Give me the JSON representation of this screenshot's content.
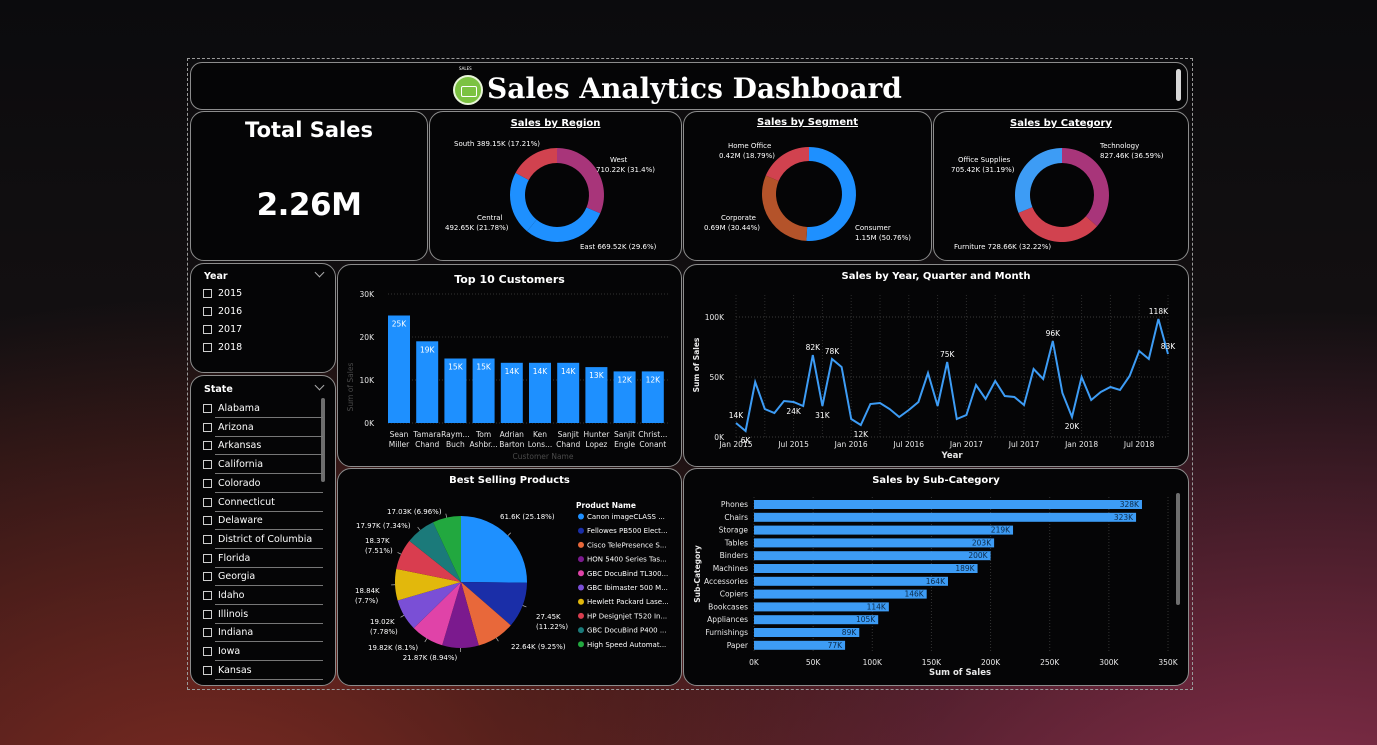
{
  "header": {
    "title": "Sales Analytics Dashboard",
    "logo_text": "SALES"
  },
  "kpi": {
    "label": "Total Sales",
    "value": "2.26M"
  },
  "region": {
    "title": "Sales by Region",
    "labels": [
      "West\n710.22K (31.4%)",
      "East 669.52K (29.6%)",
      "Central\n492.65K (21.78%)",
      "South 389.15K (17.21%)"
    ]
  },
  "segment": {
    "title": "Sales by Segment",
    "labels": [
      "Consumer\n1.15M (50.76%)",
      "Corporate\n0.69M (30.44%)",
      "Home Office\n0.42M (18.79%)"
    ]
  },
  "category": {
    "title": "Sales by Category",
    "labels": [
      "Technology\n827.46K (36.59%)",
      "Furniture 728.66K (32.22%)",
      "Office Supplies\n705.42K (31.19%)"
    ]
  },
  "year_slicer": {
    "title": "Year",
    "items": [
      "2015",
      "2016",
      "2017",
      "2018"
    ]
  },
  "state_slicer": {
    "title": "State",
    "items": [
      "Alabama",
      "Arizona",
      "Arkansas",
      "California",
      "Colorado",
      "Connecticut",
      "Delaware",
      "District of Columbia",
      "Florida",
      "Georgia",
      "Idaho",
      "Illinois",
      "Indiana",
      "Iowa",
      "Kansas"
    ]
  },
  "top_customers": {
    "title": "Top 10 Customers",
    "xlabel": "Customer Name",
    "ylabel": "Sum of Sales"
  },
  "timeline": {
    "title": "Sales by Year, Quarter and Month",
    "xlabel": "Year",
    "ylabel": "Sum of Sales"
  },
  "products": {
    "title": "Best Selling Products",
    "legend_title": "Product Name"
  },
  "subcat": {
    "title": "Sales by Sub-Category",
    "xlabel": "Sum of Sales",
    "ylabel": "Sub-Category"
  },
  "colors": {
    "blue": "#1e90ff",
    "purple": "#a8357a",
    "red": "#d1424f",
    "orange": "#b4532a",
    "lightblue": "#3d9cf5"
  },
  "chart_data": [
    {
      "type": "pie",
      "title": "Sales by Region",
      "categories": [
        "West",
        "East",
        "Central",
        "South"
      ],
      "values": [
        710.22,
        669.52,
        492.65,
        389.15
      ],
      "unit": "K",
      "colors": [
        "#a8357a",
        "#1e90ff",
        "#1e90ff",
        "#d1424f"
      ]
    },
    {
      "type": "pie",
      "title": "Sales by Segment",
      "categories": [
        "Consumer",
        "Corporate",
        "Home Office"
      ],
      "values": [
        1.15,
        0.69,
        0.42
      ],
      "unit": "M",
      "colors": [
        "#1e90ff",
        "#b4532a",
        "#d1424f"
      ]
    },
    {
      "type": "pie",
      "title": "Sales by Category",
      "categories": [
        "Technology",
        "Furniture",
        "Office Supplies"
      ],
      "values": [
        827.46,
        728.66,
        705.42
      ],
      "unit": "K",
      "colors": [
        "#a8357a",
        "#d1424f",
        "#3d9cf5"
      ]
    },
    {
      "type": "bar",
      "title": "Top 10 Customers",
      "categories": [
        "Sean\nMiller",
        "Tamara\nChand",
        "Raym...\nBuch",
        "Tom\nAshbr...",
        "Adrian\nBarton",
        "Ken\nLons...",
        "Sanjit\nChand",
        "Hunter\nLopez",
        "Sanjit\nEngle",
        "Christ...\nConant"
      ],
      "values": [
        25,
        19,
        15,
        15,
        14,
        14,
        14,
        13,
        12,
        12
      ],
      "data_labels": [
        "25K",
        "19K",
        "15K",
        "15K",
        "14K",
        "14K",
        "14K",
        "13K",
        "12K",
        "12K"
      ],
      "yticks": [
        "0K",
        "10K",
        "20K",
        "30K"
      ],
      "ylim": [
        0,
        30
      ]
    },
    {
      "type": "line",
      "title": "Sales by Year, Quarter and Month",
      "values": [
        14,
        6,
        55,
        28,
        24,
        36,
        35,
        31,
        82,
        31,
        78,
        70,
        18,
        12,
        33,
        34,
        28,
        20,
        27,
        35,
        64,
        31,
        75,
        18,
        22,
        52,
        38,
        56,
        41,
        40,
        32,
        68,
        58,
        96,
        44,
        20,
        60,
        37,
        45,
        50,
        47,
        61,
        86,
        78,
        118,
        83
      ],
      "data_labels": {
        "0": "14K",
        "1": "6K",
        "6": "24K",
        "8": "82K",
        "9": "31K",
        "10": "78K",
        "13": "12K",
        "22": "75K",
        "33": "96K",
        "35": "20K",
        "44": "118K",
        "45": "83K"
      },
      "xticks": [
        "Jan 2015",
        "Jul 2015",
        "Jan 2016",
        "Jul 2016",
        "Jan 2017",
        "Jul 2017",
        "Jan 2018",
        "Jul 2018"
      ],
      "yticks": [
        "0K",
        "50K",
        "100K"
      ],
      "ylim": [
        0,
        120
      ]
    },
    {
      "type": "pie",
      "title": "Best Selling Products",
      "categories": [
        "Canon imageCLASS ...",
        "Fellowes PB500 Elect...",
        "Cisco TelePresence S...",
        "HON 5400 Series Tas...",
        "GBC DocuBind TL300...",
        "GBC Ibimaster 500 M...",
        "Hewlett Packard Lase...",
        "HP Designjet T520 In...",
        "GBC DocuBind P400 ...",
        "High Speed Automat..."
      ],
      "values": [
        61.6,
        27.45,
        22.64,
        21.87,
        19.82,
        19.02,
        18.84,
        18.37,
        17.97,
        17.03
      ],
      "data_labels": [
        "61.6K (25.18%)",
        "27.45K\n(11.22%)",
        "22.64K (9.25%)",
        "21.87K (8.94%)",
        "19.82K (8.1%)",
        "19.02K\n(7.78%)",
        "18.84K\n(7.7%)",
        "18.37K\n(7.51%)",
        "17.97K (7.34%)",
        "17.03K (6.96%)"
      ],
      "colors": [
        "#1e90ff",
        "#1a2ea8",
        "#e8683a",
        "#7b1a8e",
        "#e043a8",
        "#7a4fd6",
        "#e2b80c",
        "#d93d4f",
        "#1b7a7a",
        "#22a83f"
      ]
    },
    {
      "type": "bar",
      "orientation": "horizontal",
      "title": "Sales by Sub-Category",
      "categories": [
        "Phones",
        "Chairs",
        "Storage",
        "Tables",
        "Binders",
        "Machines",
        "Accessories",
        "Copiers",
        "Bookcases",
        "Appliances",
        "Furnishings",
        "Paper"
      ],
      "values": [
        328,
        323,
        219,
        203,
        200,
        189,
        164,
        146,
        114,
        105,
        89,
        77
      ],
      "data_labels": [
        "328K",
        "323K",
        "219K",
        "203K",
        "200K",
        "189K",
        "164K",
        "146K",
        "114K",
        "105K",
        "89K",
        "77K"
      ],
      "xticks": [
        "0K",
        "50K",
        "100K",
        "150K",
        "200K",
        "250K",
        "300K",
        "350K"
      ],
      "xlim": [
        0,
        350
      ]
    }
  ]
}
